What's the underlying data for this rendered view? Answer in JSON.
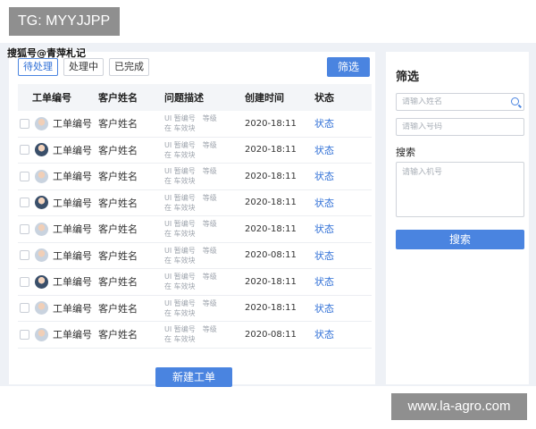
{
  "watermarks": {
    "top": "TG: MYYJJPP",
    "middle": "搜狐号@青萍札记",
    "bottom": "www.la-agro.com"
  },
  "tabs": [
    {
      "label": "待处理",
      "active": true
    },
    {
      "label": "处理中",
      "active": false
    },
    {
      "label": "已完成",
      "active": false
    }
  ],
  "toolbar": {
    "filter_label": "筛选"
  },
  "table": {
    "headers": [
      "工单编号",
      "客户姓名",
      "问题描述",
      "创建时间",
      "状态"
    ],
    "rows": [
      {
        "id": "工单编号",
        "customer": "客户姓名",
        "desc1": "UI 暂编号　等级",
        "desc2": "在 车效块",
        "time": "2020-18:11",
        "status": "状态",
        "avatar": "light"
      },
      {
        "id": "工单编号",
        "customer": "客户姓名",
        "desc1": "UI 暂编号　等级",
        "desc2": "在 车效块",
        "time": "2020-18:11",
        "status": "状态",
        "avatar": "dark"
      },
      {
        "id": "工单编号",
        "customer": "客户姓名",
        "desc1": "UI 暂编号　等级",
        "desc2": "在 车效块",
        "time": "2020-18:11",
        "status": "状态",
        "avatar": "light"
      },
      {
        "id": "工单编号",
        "customer": "客户姓名",
        "desc1": "UI 暂编号　等级",
        "desc2": "在 车效块",
        "time": "2020-18:11",
        "status": "状态",
        "avatar": "dark"
      },
      {
        "id": "工单编号",
        "customer": "客户姓名",
        "desc1": "UI 暂编号　等级",
        "desc2": "在 车效块",
        "time": "2020-18:11",
        "status": "状态",
        "avatar": "light"
      },
      {
        "id": "工单编号",
        "customer": "客户姓名",
        "desc1": "UI 暂编号　等级",
        "desc2": "在 车效块",
        "time": "2020-08:11",
        "status": "状态",
        "avatar": "light"
      },
      {
        "id": "工单编号",
        "customer": "客户姓名",
        "desc1": "UI 暂编号　等级",
        "desc2": "在 车效块",
        "time": "2020-18:11",
        "status": "状态",
        "avatar": "dark"
      },
      {
        "id": "工单编号",
        "customer": "客户姓名",
        "desc1": "UI 暂编号　等级",
        "desc2": "在 车效块",
        "time": "2020-18:11",
        "status": "状态",
        "avatar": "light"
      },
      {
        "id": "工单编号",
        "customer": "客户姓名",
        "desc1": "UI 暂编号　等级",
        "desc2": "在 车效块",
        "time": "2020-08:11",
        "status": "状态",
        "avatar": "light"
      }
    ]
  },
  "new_ticket_label": "新建工单",
  "side": {
    "title": "筛选",
    "name_placeholder": "请输入姓名",
    "phone_placeholder": "请输入号码",
    "search_label": "搜索",
    "search_box_placeholder": "请输入机号",
    "search_button": "搜索"
  },
  "colors": {
    "accent": "#4a84e0",
    "status_text": "#2f6fd6",
    "panel_bg": "#eef1f6"
  }
}
